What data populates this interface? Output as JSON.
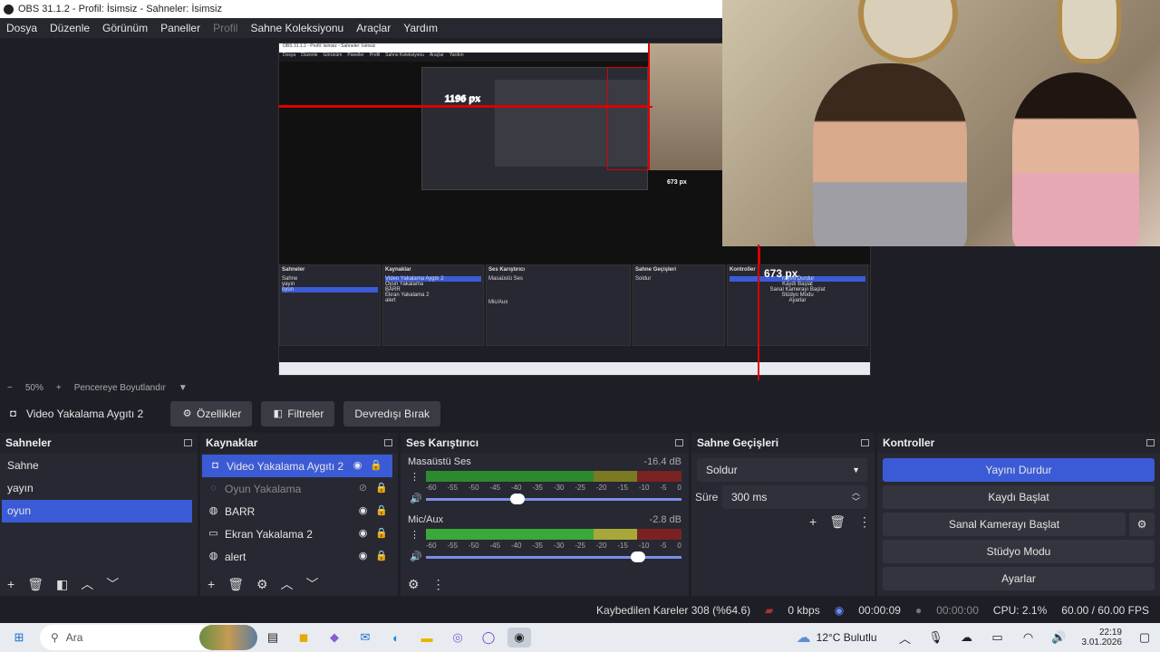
{
  "window": {
    "title": "OBS 31.1.2 - Profil: İsimsiz - Sahneler: İsimsiz"
  },
  "menu": [
    "Dosya",
    "Düzenle",
    "Görünüm",
    "Paneller",
    "Profil",
    "Sahne Koleksiyonu",
    "Araçlar",
    "Yardım"
  ],
  "preview": {
    "label_width": "1196 px",
    "label_height": "673 px",
    "nested_title": "OBS 31.1.2 - Profil: İsimsiz - Sahneler: İsimsiz",
    "nested_menu": [
      "Dosya",
      "Düzenle",
      "Görünüm",
      "Paneller",
      "Profil",
      "Sahne Koleksiyonu",
      "Araçlar",
      "Yardım"
    ],
    "nested_label_width": "1196 px",
    "nested_label_height": "673 px"
  },
  "zoom": {
    "value": "50%",
    "mode": "Pencereye Boyutlandır"
  },
  "source_toolbar": {
    "source_name": "Video Yakalama Aygıtı 2",
    "properties": "Özellikler",
    "filters": "Filtreler",
    "deactivate": "Devredışı Bırak"
  },
  "scenes": {
    "title": "Sahneler",
    "items": [
      "Sahne",
      "yayın",
      "oyun"
    ],
    "selected": "oyun"
  },
  "sources": {
    "title": "Kaynaklar",
    "items": [
      {
        "label": "Video Yakalama Aygıtı 2",
        "icon": "camera-icon"
      },
      {
        "label": "Oyun Yakalama",
        "icon": "gamepad-icon"
      },
      {
        "label": "BARR",
        "icon": "globe-icon"
      },
      {
        "label": "Ekran Yakalama 2",
        "icon": "monitor-icon"
      },
      {
        "label": "alert",
        "icon": "globe-icon"
      }
    ]
  },
  "mixer": {
    "title": "Ses Karıştırıcı",
    "channels": [
      {
        "name": "Masaüstü Ses",
        "db": "-16.4 dB",
        "level": 0.35
      },
      {
        "name": "Mic/Aux",
        "db": "-2.8 dB",
        "level": 0.85
      }
    ],
    "ticks": [
      "-60",
      "-55",
      "-50",
      "-45",
      "-40",
      "-35",
      "-30",
      "-25",
      "-20",
      "-15",
      "-10",
      "-5",
      "0"
    ]
  },
  "transitions": {
    "title": "Sahne Geçişleri",
    "selected": "Soldur",
    "duration_label": "Süre",
    "duration_value": "300 ms"
  },
  "controls": {
    "title": "Kontroller",
    "buttons": [
      "Yayını Durdur",
      "Kaydı Başlat",
      "Sanal Kamerayı Başlat",
      "Stüdyo Modu",
      "Ayarlar"
    ]
  },
  "status": {
    "dropped": "Kaybedilen Kareler 308 (%64.6)",
    "kbps": "0 kbps",
    "stream_time": "00:00:09",
    "rec_time": "00:00:00",
    "cpu": "CPU: 2.1%",
    "fps": "60.00 / 60.00 FPS"
  },
  "taskbar": {
    "search": "Ara",
    "weather": "12°C Bulutlu",
    "time": "22:19",
    "date": "3.01.2026"
  },
  "colors": {
    "accent": "#3b5bd6",
    "meter_green": "#3aa83a",
    "meter_yellow": "#a8a83a",
    "meter_red": "#a83a3a"
  }
}
